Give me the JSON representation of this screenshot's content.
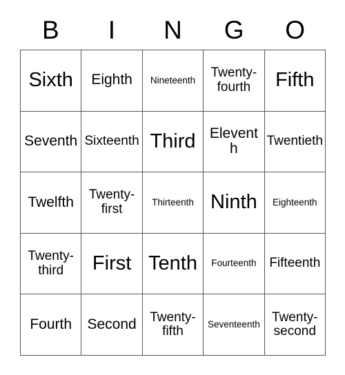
{
  "card": {
    "title": "BINGO",
    "headers": [
      "B",
      "I",
      "N",
      "G",
      "O"
    ],
    "rows": [
      [
        {
          "text": "Sixth",
          "size": "lg"
        },
        {
          "text": "Eighth",
          "size": "md"
        },
        {
          "text": "Nineteenth",
          "size": "xs"
        },
        {
          "text": "Twenty-fourth",
          "size": "sm"
        },
        {
          "text": "Fifth",
          "size": "lg"
        }
      ],
      [
        {
          "text": "Seventh",
          "size": "md"
        },
        {
          "text": "Sixteenth",
          "size": "sm"
        },
        {
          "text": "Third",
          "size": "lg"
        },
        {
          "text": "Eleventh",
          "size": "md"
        },
        {
          "text": "Twentieth",
          "size": "sm"
        }
      ],
      [
        {
          "text": "Twelfth",
          "size": "md"
        },
        {
          "text": "Twenty-first",
          "size": "sm"
        },
        {
          "text": "Thirteenth",
          "size": "xs"
        },
        {
          "text": "Ninth",
          "size": "lg"
        },
        {
          "text": "Eighteenth",
          "size": "xs"
        }
      ],
      [
        {
          "text": "Twenty-third",
          "size": "sm"
        },
        {
          "text": "First",
          "size": "lg"
        },
        {
          "text": "Tenth",
          "size": "lg"
        },
        {
          "text": "Fourteenth",
          "size": "xs"
        },
        {
          "text": "Fifteenth",
          "size": "sm"
        }
      ],
      [
        {
          "text": "Fourth",
          "size": "md"
        },
        {
          "text": "Second",
          "size": "md"
        },
        {
          "text": "Twenty-fifth",
          "size": "sm"
        },
        {
          "text": "Seventeenth",
          "size": "xs"
        },
        {
          "text": "Twenty-second",
          "size": "sm"
        }
      ]
    ]
  },
  "colors": {
    "background": "#ffffff",
    "border": "#555555",
    "text": "#000000"
  }
}
